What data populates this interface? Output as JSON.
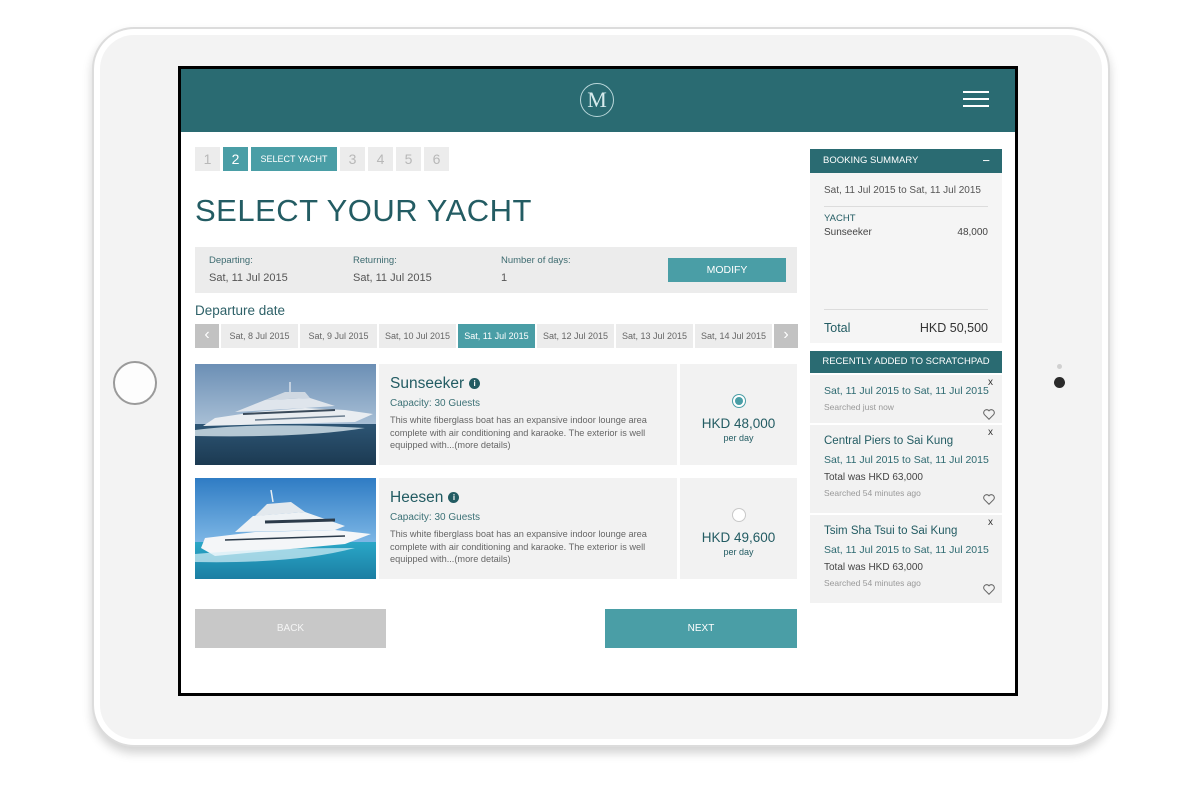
{
  "header": {
    "logo_letter": "M"
  },
  "steps": {
    "items": [
      "1",
      "2",
      "3",
      "4",
      "5",
      "6"
    ],
    "active": "2",
    "active_label": "SELECT YACHT"
  },
  "page_title": "SELECT YOUR YACHT",
  "trip": {
    "departing_label": "Departing:",
    "departing_value": "Sat, 11 Jul 2015",
    "returning_label": "Returning:",
    "returning_value": "Sat, 11 Jul 2015",
    "days_label": "Number of days:",
    "days_value": "1",
    "modify_label": "MODIFY"
  },
  "departure_date": {
    "label": "Departure date",
    "dates": [
      "Sat, 8 Jul 2015",
      "Sat, 9 Jul 2015",
      "Sat, 10 Jul 2015",
      "Sat, 11 Jul 2015",
      "Sat, 12 Jul 2015",
      "Sat, 13 Jul 2015",
      "Sat, 14 Jul 2015"
    ],
    "selected": "Sat, 11 Jul 2015"
  },
  "yachts": [
    {
      "name": "Sunseeker",
      "capacity": "Capacity: 30 Guests",
      "description": "This white fiberglass boat has an expansive indoor lounge area complete with air conditioning and karaoke. The exterior is well equipped with...(more details)",
      "price": "HKD 48,000",
      "per": "per day",
      "selected": true
    },
    {
      "name": "Heesen",
      "capacity": "Capacity: 30 Guests",
      "description": "This white fiberglass boat has an expansive indoor lounge area complete with air conditioning and karaoke. The exterior is well equipped with...(more details)",
      "price": "HKD 49,600",
      "per": "per day",
      "selected": false
    }
  ],
  "buttons": {
    "back": "BACK",
    "next": "NEXT"
  },
  "summary": {
    "title": "BOOKING SUMMARY",
    "collapse": "−",
    "dates": "Sat, 11 Jul 2015 to Sat, 11 Jul 2015",
    "category": "YACHT",
    "yacht": "Sunseeker",
    "yacht_price": "48,000",
    "total_label": "Total",
    "total_value": "HKD 50,500"
  },
  "scratchpad": {
    "title": "RECENTLY ADDED TO SCRATCHPAD",
    "items": [
      {
        "route": "",
        "dates": "Sat, 11 Jul 2015 to Sat, 11 Jul 2015",
        "total": "",
        "time": "Searched just now"
      },
      {
        "route": "Central Piers to Sai Kung",
        "dates": "Sat, 11 Jul 2015 to Sat, 11 Jul 2015",
        "total": "Total was HKD 63,000",
        "time": "Searched 54 minutes ago"
      },
      {
        "route": "Tsim Sha Tsui to Sai Kung",
        "dates": "Sat, 11 Jul 2015 to Sat, 11 Jul 2015",
        "total": "Total was HKD 63,000",
        "time": "Searched 54 minutes ago"
      }
    ]
  },
  "colors": {
    "primary": "#2a6b72",
    "accent": "#4a9ea6",
    "panel": "#f2f2f2"
  }
}
